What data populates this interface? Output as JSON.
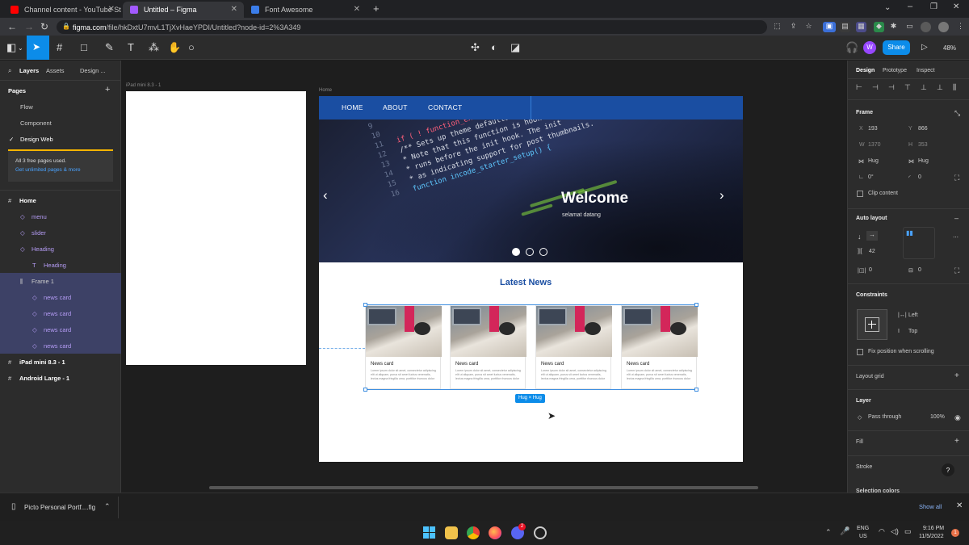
{
  "browser": {
    "tabs": [
      {
        "title": "Channel content - YouTube Studi",
        "color": "#ff0000"
      },
      {
        "title": "Untitled – Figma",
        "color": "#a259ff"
      },
      {
        "title": "Font Awesome",
        "color": "#3b7de9"
      }
    ],
    "url_host": "figma.com",
    "url_path": "/file/hkDxtU7mvL1TjXvHaeYPDI/Untitled?node-id=2%3A349"
  },
  "toolbar": {
    "share_label": "Share",
    "zoom": "48%",
    "avatar": "W"
  },
  "left_panel": {
    "tabs": [
      "Layers",
      "Assets",
      "Design ..."
    ],
    "pages_label": "Pages",
    "pages": [
      "Flow",
      "Component",
      "Design Web"
    ],
    "notice_line1": "All 3 free pages used.",
    "notice_line2": "Get unlimited pages & more",
    "layers": [
      {
        "label": "Home",
        "indent": 0,
        "selected": false,
        "purple": false,
        "icon": "#"
      },
      {
        "label": "menu",
        "indent": 1,
        "selected": false,
        "purple": true,
        "icon": "◇"
      },
      {
        "label": "slider",
        "indent": 1,
        "selected": false,
        "purple": true,
        "icon": "◇"
      },
      {
        "label": "Heading",
        "indent": 1,
        "selected": false,
        "purple": true,
        "icon": "◇"
      },
      {
        "label": "Heading",
        "indent": 2,
        "selected": false,
        "purple": true,
        "icon": "T"
      },
      {
        "label": "Frame 1",
        "indent": 1,
        "selected": true,
        "purple": false,
        "icon": "⫼"
      },
      {
        "label": "news card",
        "indent": 2,
        "selected": true,
        "purple": true,
        "icon": "◇"
      },
      {
        "label": "news card",
        "indent": 2,
        "selected": true,
        "purple": true,
        "icon": "◇"
      },
      {
        "label": "news card",
        "indent": 2,
        "selected": true,
        "purple": true,
        "icon": "◇"
      },
      {
        "label": "news card",
        "indent": 2,
        "selected": true,
        "purple": true,
        "icon": "◇"
      },
      {
        "label": "iPad mini 8.3 - 1",
        "indent": 0,
        "selected": false,
        "purple": false,
        "icon": "#"
      },
      {
        "label": "Android Large - 1",
        "indent": 0,
        "selected": false,
        "purple": false,
        "icon": "#"
      }
    ]
  },
  "canvas": {
    "ipad_label": "iPad mini 8.3 - 1",
    "home_label": "Home",
    "nav": [
      "HOME",
      "ABOUT",
      "CONTACT"
    ],
    "hero_title": "Welcome",
    "hero_subtitle": "selamat datang",
    "section_title": "Latest News",
    "card_title": "News card",
    "card_text": "Lorem ipsum dolor sit amet, consectetur adipiscing elit ut aliquam, purus sit amet luctus venenatis, lectus magna fringilla urna, porttitor rhoncus dolor",
    "selection_badge": "Hug × Hug",
    "code_lines": [
      "if ( ! function_exists(",
      "/** Sets up theme defaults",
      " * Note that this function is hooked",
      " * runs before the init hook. The init",
      " * as indicating support for post thumbnails.",
      "function incode_starter_setup() {",
      "",
      ""
    ],
    "line_numbers": [
      "9",
      "10",
      "11",
      "12",
      "13",
      "14",
      "15",
      "16"
    ]
  },
  "right_panel": {
    "tabs": [
      "Design",
      "Prototype",
      "Inspect"
    ],
    "frame_label": "Frame",
    "x_label": "X",
    "x": "193",
    "y_label": "Y",
    "y": "866",
    "w_label": "W",
    "w": "1370",
    "h_label": "H",
    "h": "353",
    "hug_w": "Hug",
    "hug_h": "Hug",
    "rotation": "0°",
    "radius": "0",
    "clip_content": "Clip content",
    "auto_layout": "Auto layout",
    "spacing": "42",
    "padding_h": "0",
    "padding_v": "0",
    "constraints": "Constraints",
    "constraint_h": "Left",
    "constraint_v": "Top",
    "fix_position": "Fix position when scrolling",
    "layout_grid": "Layout grid",
    "layer": "Layer",
    "blend": "Pass through",
    "opacity": "100%",
    "fill": "Fill",
    "stroke": "Stroke",
    "selection_colors": "Selection colors",
    "help": "?"
  },
  "download_bar": {
    "file": "Picto Personal Portf....fig",
    "show_all": "Show all"
  },
  "taskbar": {
    "lang1": "ENG",
    "lang2": "US",
    "time": "9:16 PM",
    "date": "11/5/2022",
    "notif": "1",
    "discord_badge": "2"
  }
}
